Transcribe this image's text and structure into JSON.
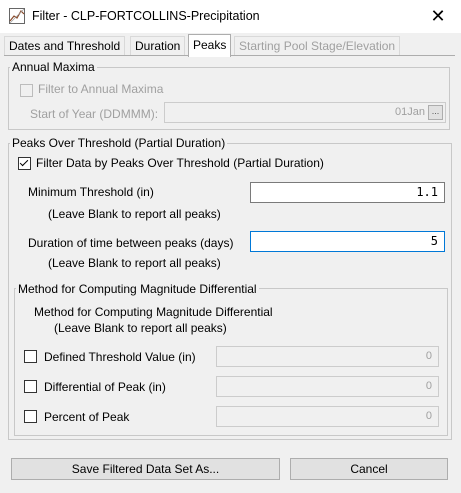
{
  "window": {
    "title": "Filter - CLP-FORTCOLLINS-Precipitation",
    "close_glyph": "✕"
  },
  "tabs": [
    {
      "label": "Dates and Threshold",
      "state": "normal"
    },
    {
      "label": "Duration",
      "state": "normal"
    },
    {
      "label": "Peaks",
      "state": "active"
    },
    {
      "label": "Starting Pool Stage/Elevation",
      "state": "disabled"
    }
  ],
  "annual_maxima": {
    "legend": "Annual Maxima",
    "filter_label": "Filter to Annual Maxima",
    "filter_checked": false,
    "start_label": "Start of Year (DDMMM):",
    "start_value": "01Jan",
    "browse_label": "..."
  },
  "peaks_over_threshold": {
    "legend": "Peaks Over Threshold (Partial Duration)",
    "filter_label": "Filter Data by Peaks Over Threshold (Partial Duration)",
    "filter_checked": true,
    "min_threshold_label": "Minimum Threshold (in)",
    "min_threshold_value": "1.1",
    "min_threshold_hint": "(Leave Blank to report all peaks)",
    "duration_label": "Duration of time between peaks (days)",
    "duration_value": "5",
    "duration_hint": "(Leave Blank to report all peaks)"
  },
  "magnitude": {
    "legend": "Method for Computing Magnitude Differential",
    "heading": "Method for Computing Magnitude Differential",
    "hint": "(Leave Blank to report all peaks)",
    "options": [
      {
        "label": "Defined Threshold Value (in)",
        "value": "0",
        "checked": false
      },
      {
        "label": "Differential of Peak (in)",
        "value": "0",
        "checked": false
      },
      {
        "label": "Percent of Peak",
        "value": "0",
        "checked": false
      }
    ]
  },
  "buttons": {
    "save": "Save Filtered Data Set As...",
    "cancel": "Cancel"
  },
  "colors": {
    "focus_border": "#0078d7",
    "disabled_text": "#a0a0a0"
  }
}
